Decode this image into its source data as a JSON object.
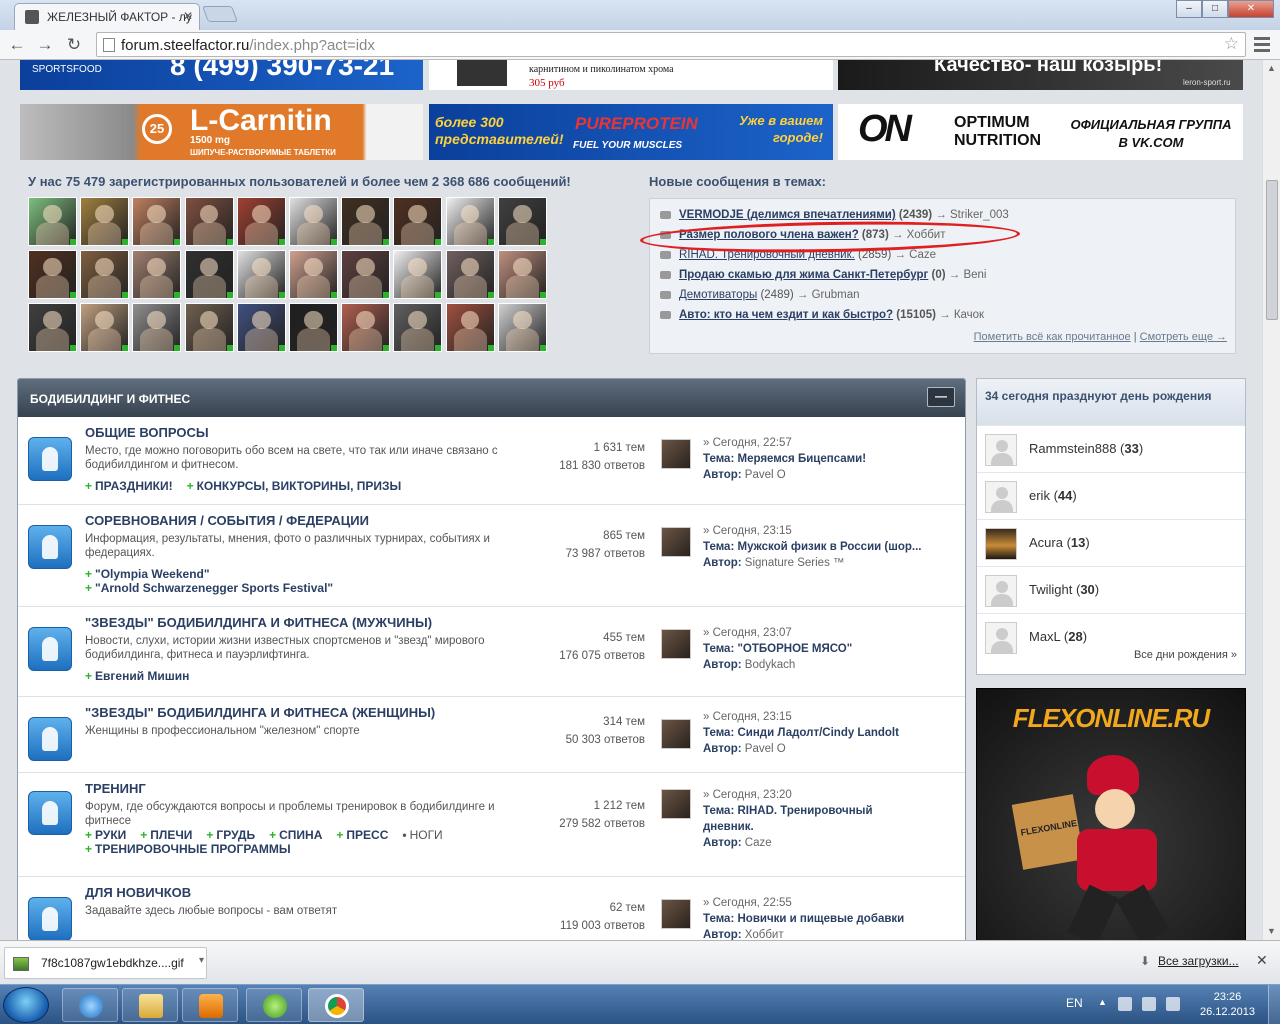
{
  "browser": {
    "tab_title": "ЖЕЛЕЗНЫЙ ФАКТОР - лу",
    "url_host": "forum.steelfactor.ru",
    "url_path": "/index.php?act=idx",
    "window_buttons": {
      "minimize": "‒",
      "maximize": "□",
      "close": "✕"
    }
  },
  "banners": {
    "top_left": {
      "brand": "SPORTSFOOD",
      "phone": "8 (499) 390-73-21"
    },
    "top_mid": {
      "text": "карнитином и пиколинатом хрома",
      "price": "305 руб"
    },
    "top_right": {
      "slogan": "Качество- наш козырь!",
      "site": "leron-sport.ru"
    },
    "carnitin": {
      "title": "L-Carnitin",
      "dose": "1500 mg",
      "sub": "ШИПУЧЕ-РАСТВОРИМЫЕ ТАБЛЕТКИ"
    },
    "pureprotein": {
      "left": "более 300 представителей!",
      "brand": "PUREPROTEIN",
      "sub": "FUEL YOUR MUSCLES",
      "right": "Уже в вашем городе!"
    },
    "optimum": {
      "logo": "ON",
      "brand": "OPTIMUM NUTRITION",
      "right": "ОФИЦИАЛЬНАЯ ГРУППА В VK.COM"
    }
  },
  "stats": {
    "text": "У нас 75 479 зарегистрированных пользователей и более чем 2 368 686 сообщений!"
  },
  "avatars": [
    "#7fbf7f",
    "#a08040",
    "#c08060",
    "#805040",
    "#a04030",
    "#e0e0e0",
    "#403020",
    "#503020",
    "#f0f0f0",
    "#404040",
    "#503020",
    "#806040",
    "#a08070",
    "#303030",
    "#e0e0e0",
    "#d0a090",
    "#604040",
    "#f0f0f0",
    "#706060",
    "#c09080",
    "#404040",
    "#c0a080",
    "#909090",
    "#706050",
    "#405080",
    "#202020",
    "#b06050",
    "#606060",
    "#a05040",
    "#d0d0d0"
  ],
  "new_posts": {
    "title": "Новые сообщения в темах:",
    "items": [
      {
        "topic": "VERMODJE (делимся впечатлениями)",
        "count": "(2439)",
        "user": "→ Striker_003",
        "bold": true
      },
      {
        "topic": "Размер полового члена важен?",
        "count": "(873)",
        "user": "→ Хоббит",
        "bold": true
      },
      {
        "topic": "RIHAD. Тренировочный дневник.",
        "count": "(2859)",
        "user": "→ Caze",
        "bold": false
      },
      {
        "topic": "Продаю скамью для жима Санкт-Петербург",
        "count": "(0)",
        "user": "→ Beni",
        "bold": true
      },
      {
        "topic": "Демотиваторы",
        "count": "(2489)",
        "user": "→ Grubman",
        "bold": false
      },
      {
        "topic": "Авто: кто на чем ездит и как быстро?",
        "count": "(15105)",
        "user": "→ Качок",
        "bold": true
      }
    ],
    "mark_read": "Пометить всё как прочитанное",
    "separator": "|",
    "see_more": "Смотреть еще →"
  },
  "forum": {
    "category": "БОДИБИЛДИНГ И ФИТНЕС",
    "collapse": "—",
    "rows": [
      {
        "title": "ОБЩИЕ ВОПРОСЫ",
        "desc": "Место, где можно поговорить обо всем на свете, что так или иначе связано с бодибилдингом и фитнесом.",
        "subs": [
          "ПРАЗДНИКИ!",
          "КОНКУРСЫ, ВИКТОРИНЫ, ПРИЗЫ"
        ],
        "topics": "1 631 тем",
        "replies": "181 830 ответов",
        "last_date": "» Сегодня, 22:57",
        "last_topic": "Меряемся Бицепсами!",
        "last_author": "Pavel O"
      },
      {
        "title": "СОРЕВНОВАНИЯ / СОБЫТИЯ / ФЕДЕРАЦИИ",
        "desc": "Информация, результаты, мнения, фото о различных турнирах, событиях и федерациях.",
        "subs": [
          "\"Olympia Weekend\"",
          "\"Arnold Schwarzenegger Sports Festival\""
        ],
        "topics": "865 тем",
        "replies": "73 987 ответов",
        "last_date": "» Сегодня, 23:15",
        "last_topic": "Мужской физик в России (шор...",
        "last_author": "Signature Series ™"
      },
      {
        "title": "\"ЗВЕЗДЫ\" БОДИБИЛДИНГА И ФИТНЕСА (МУЖЧИНЫ)",
        "desc": "Новости, слухи, истории жизни известных спортсменов и \"звезд\" мирового бодибилдинга, фитнеса и пауэрлифтинга.",
        "subs": [
          "Евгений Мишин"
        ],
        "topics": "455 тем",
        "replies": "176 075 ответов",
        "last_date": "» Сегодня, 23:07",
        "last_topic": "\"ОТБОРНОЕ МЯСО\"",
        "last_author": "Bodykach"
      },
      {
        "title": "\"ЗВЕЗДЫ\" БОДИБИЛДИНГА И ФИТНЕСА (ЖЕНЩИНЫ)",
        "desc": "Женщины в профессиональном \"железном\" спорте",
        "subs": [],
        "topics": "314 тем",
        "replies": "50 303 ответов",
        "last_date": "» Сегодня, 23:15",
        "last_topic": "Синди Ладолт/Cindy Landolt",
        "last_author": "Pavel O"
      },
      {
        "title": "ТРЕНИНГ",
        "desc": "Форум, где обсуждаются вопросы и проблемы тренировок в бодибилдинге и фитнесе",
        "subs": [
          "РУКИ",
          "ПЛЕЧИ",
          "ГРУДЬ",
          "СПИНА",
          "ПРЕСС",
          "НОГИ",
          "ТРЕНИРОВОЧНЫЕ ПРОГРАММЫ"
        ],
        "topics": "1 212 тем",
        "replies": "279 582 ответов",
        "last_date": "» Сегодня, 23:20",
        "last_topic": "RIHAD. Тренировочный",
        "last_topic2": "дневник.",
        "last_author": "Caze"
      },
      {
        "title": "ДЛЯ НОВИЧКОВ",
        "desc": "Задавайте здесь любые вопросы - вам ответят",
        "subs": [],
        "topics": "62 тем",
        "replies": "119 003 ответов",
        "last_date": "» Сегодня, 22:55",
        "last_topic": "Новички и пищевые добавки",
        "last_author": "Хоббит"
      }
    ],
    "label_topic": "Тема:",
    "label_author": "Автор:"
  },
  "birthdays": {
    "title": "34 сегодня празднуют день рождения",
    "people": [
      {
        "name": "Rammstein888",
        "age": "33"
      },
      {
        "name": "erik",
        "age": "44"
      },
      {
        "name": "Acura",
        "age": "13"
      },
      {
        "name": "Twilight",
        "age": "30"
      },
      {
        "name": "MaxL",
        "age": "28"
      }
    ],
    "all_link": "Все дни рождения »"
  },
  "flex_banner": {
    "title": "FLEXONLINE.RU",
    "box_label": "FLEXONLINE"
  },
  "downloads": {
    "file": "7f8c1087gw1ebdkhze....gif",
    "all": "Все загрузки...",
    "close": "✕"
  },
  "taskbar": {
    "lang": "EN",
    "time": "23:26",
    "date": "26.12.2013"
  }
}
